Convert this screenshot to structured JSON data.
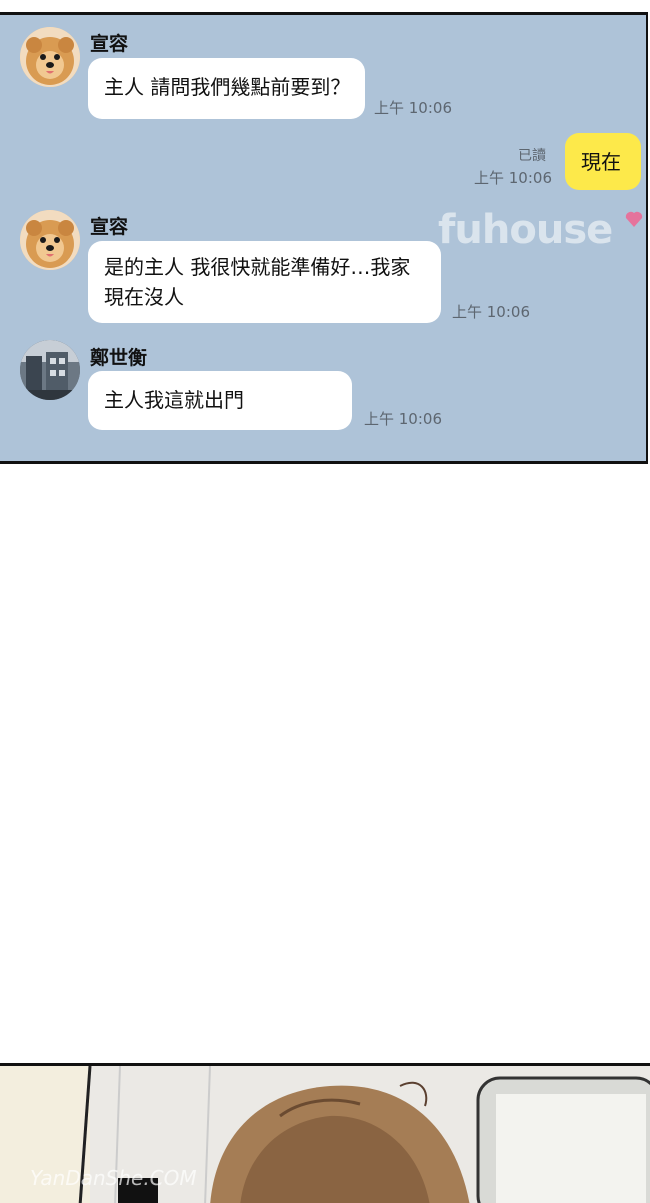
{
  "messages": [
    {
      "sender": "宣容",
      "lines": [
        "主人 請問我們幾點前要到？"
      ],
      "time": "上午 10:06",
      "avatar": "pomeranian-avatar"
    },
    {
      "mine": true,
      "lines": [
        "現在"
      ],
      "read": "已讀",
      "time": "上午 10:06"
    },
    {
      "sender": "宣容",
      "lines": [
        "是的主人 我很快就能準備好…我家",
        "現在沒人"
      ],
      "time": "上午 10:06",
      "avatar": "pomeranian-avatar"
    },
    {
      "sender": "鄭世衡",
      "lines": [
        "主人我這就出門"
      ],
      "time": "上午 10:06",
      "avatar": "street-avatar"
    }
  ],
  "watermarks": {
    "top": "fuhouse",
    "bottom": "YanDanShe.COM"
  },
  "colors": {
    "chat_bg": "#aec3d8",
    "my_bubble": "#fde94a",
    "their_bubble": "#ffffff"
  }
}
